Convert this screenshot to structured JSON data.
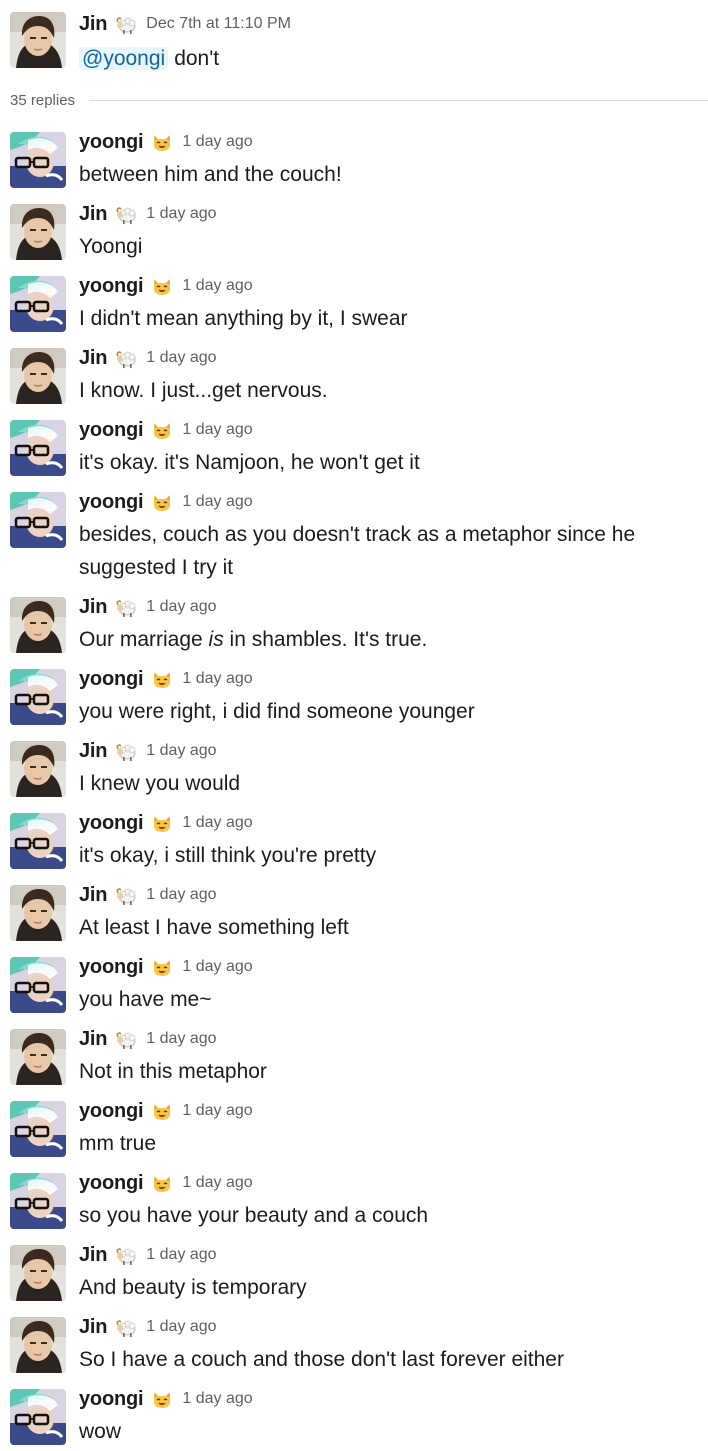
{
  "parent": {
    "user": "Jin",
    "time": "Dec 7th at 11:10 PM",
    "mention": "@yoongi",
    "text": "don't"
  },
  "thread": {
    "replies_label": "35 replies"
  },
  "users": {
    "jin": {
      "name": "Jin",
      "emoji": "ram-emoji"
    },
    "yoongi": {
      "name": "yoongi",
      "emoji": "cat-emoji"
    }
  },
  "replies": [
    {
      "user": "yoongi",
      "time": "1 day ago",
      "text": "between him and the couch!"
    },
    {
      "user": "Jin",
      "time": "1 day ago",
      "text": "Yoongi"
    },
    {
      "user": "yoongi",
      "time": "1 day ago",
      "text": "I didn't mean anything by it, I swear"
    },
    {
      "user": "Jin",
      "time": "1 day ago",
      "text": "I know. I just...get nervous."
    },
    {
      "user": "yoongi",
      "time": "1 day ago",
      "text": "it's okay. it's Namjoon, he won't get it"
    },
    {
      "user": "yoongi",
      "time": "1 day ago",
      "text": "besides, couch as you doesn't track as a metaphor since he suggested I try it"
    },
    {
      "user": "Jin",
      "time": "1 day ago",
      "text_before": "Our marriage ",
      "text_em": "is",
      "text_after": " in shambles. It's true."
    },
    {
      "user": "yoongi",
      "time": "1 day ago",
      "text": "you were right, i did find someone younger"
    },
    {
      "user": "Jin",
      "time": "1 day ago",
      "text": "I knew you would"
    },
    {
      "user": "yoongi",
      "time": "1 day ago",
      "text": "it's okay, i still think you're pretty"
    },
    {
      "user": "Jin",
      "time": "1 day ago",
      "text": "At least I have something left"
    },
    {
      "user": "yoongi",
      "time": "1 day ago",
      "text": "you have me~"
    },
    {
      "user": "Jin",
      "time": "1 day ago",
      "text": "Not in this metaphor"
    },
    {
      "user": "yoongi",
      "time": "1 day ago",
      "text": "mm true"
    },
    {
      "user": "yoongi",
      "time": "1 day ago",
      "text": "so you have your beauty and a couch"
    },
    {
      "user": "Jin",
      "time": "1 day ago",
      "text": "And beauty is temporary"
    },
    {
      "user": "Jin",
      "time": "1 day ago",
      "text": "So I have a couch and those don't last forever either"
    },
    {
      "user": "yoongi",
      "time": "1 day ago",
      "text": "wow"
    }
  ]
}
